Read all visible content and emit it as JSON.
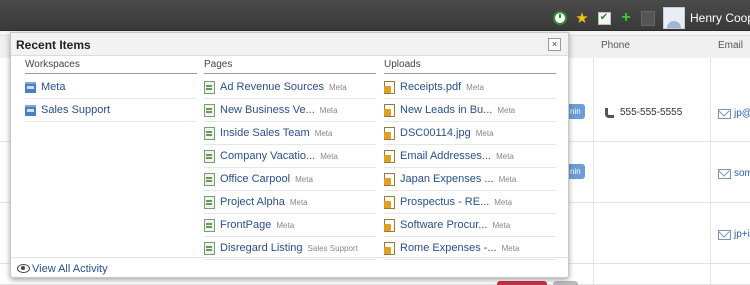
{
  "user": {
    "name": "Henry Cooper"
  },
  "top_icons": [
    "clock-icon",
    "star-icon",
    "checkbox-icon",
    "plus-icon",
    "square-icon",
    "avatar"
  ],
  "background_table": {
    "columns": {
      "phone": "Phone",
      "email": "Email"
    },
    "rows": [
      {
        "badge": "nin",
        "phone": "555-555-5555",
        "email": "jp@"
      },
      {
        "badge": "nin",
        "phone": "",
        "email": "som"
      },
      {
        "badge": "",
        "phone": "",
        "email": "jp+ir"
      }
    ]
  },
  "panel": {
    "title": "Recent Items",
    "close_label": "×",
    "workspaces": {
      "header": "Workspaces",
      "items": [
        {
          "label": "Meta"
        },
        {
          "label": "Sales Support"
        }
      ]
    },
    "pages": {
      "header": "Pages",
      "items": [
        {
          "label": "Ad Revenue Sources",
          "sub": "Meta"
        },
        {
          "label": "New Business Ve...",
          "sub": "Meta"
        },
        {
          "label": "Inside Sales Team",
          "sub": "Meta"
        },
        {
          "label": "Company Vacatio...",
          "sub": "Meta"
        },
        {
          "label": "Office Carpool",
          "sub": "Meta"
        },
        {
          "label": "Project Alpha",
          "sub": "Meta"
        },
        {
          "label": "FrontPage",
          "sub": "Meta"
        },
        {
          "label": "Disregard Listing",
          "sub": "Sales Support"
        }
      ]
    },
    "uploads": {
      "header": "Uploads",
      "items": [
        {
          "label": "Receipts.pdf",
          "sub": "Meta"
        },
        {
          "label": "New Leads in Bu...",
          "sub": "Meta"
        },
        {
          "label": "DSC00114.jpg",
          "sub": "Meta"
        },
        {
          "label": "Email Addresses...",
          "sub": "Meta"
        },
        {
          "label": "Japan Expenses ...",
          "sub": "Meta"
        },
        {
          "label": "Prospectus - RE...",
          "sub": "Meta"
        },
        {
          "label": "Software Procur...",
          "sub": "Meta"
        },
        {
          "label": "Rome Expenses -...",
          "sub": "Meta"
        }
      ]
    },
    "footer": {
      "link": "View All Activity"
    }
  }
}
